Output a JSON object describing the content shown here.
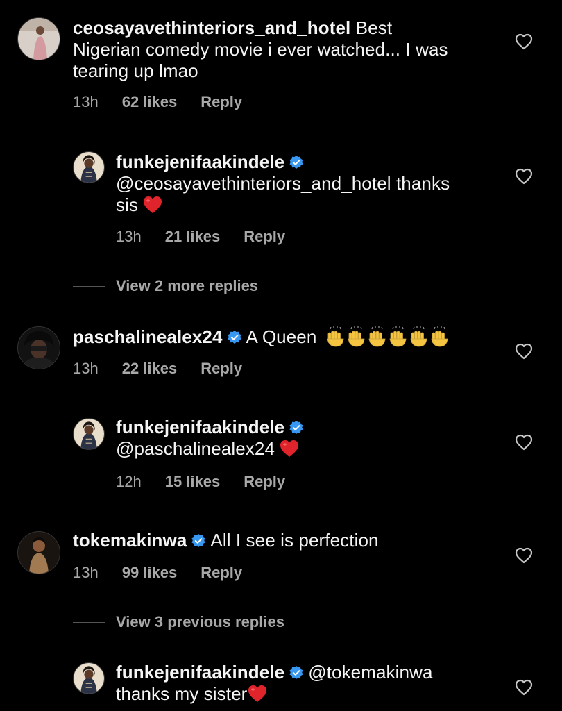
{
  "comments": [
    {
      "username": "ceosayavethinteriors_and_hotel",
      "text_line1": "Best",
      "text_line2": "Nigerian comedy movie i ever watched... I was",
      "text_line3": "tearing up lmao",
      "time": "13h",
      "likes": "62 likes",
      "reply": "Reply"
    },
    {
      "username": "funkejenifaakindele",
      "mention": "@ceosayavethinteriors_and_hotel",
      "text_after_mention": "thanks",
      "text_line2": "sis",
      "time": "13h",
      "likes": "21 likes",
      "reply": "Reply"
    },
    {
      "username": "paschalinealex24",
      "text": "A Queen",
      "time": "13h",
      "likes": "22 likes",
      "reply": "Reply"
    },
    {
      "username": "funkejenifaakindele",
      "mention": "@paschalinealex24",
      "time": "12h",
      "likes": "15 likes",
      "reply": "Reply"
    },
    {
      "username": "tokemakinwa",
      "text": "All I see is perfection",
      "time": "13h",
      "likes": "99 likes",
      "reply": "Reply"
    },
    {
      "username": "funkejenifaakindele",
      "mention": "@tokemakinwa",
      "text_line2": "thanks my sister"
    }
  ],
  "view_more_1": "View 2 more replies",
  "view_more_2": "View 3 previous replies",
  "icons": {
    "like": "heart-outline-icon",
    "verified": "verified-badge-icon",
    "red_heart": "red-heart-emoji",
    "clap": "raising-hands-emoji"
  },
  "colors": {
    "background": "#000000",
    "text": "#f5f5f5",
    "secondary": "#a8a8a8",
    "verified": "#3897f0",
    "red_heart": "#e0242b"
  }
}
